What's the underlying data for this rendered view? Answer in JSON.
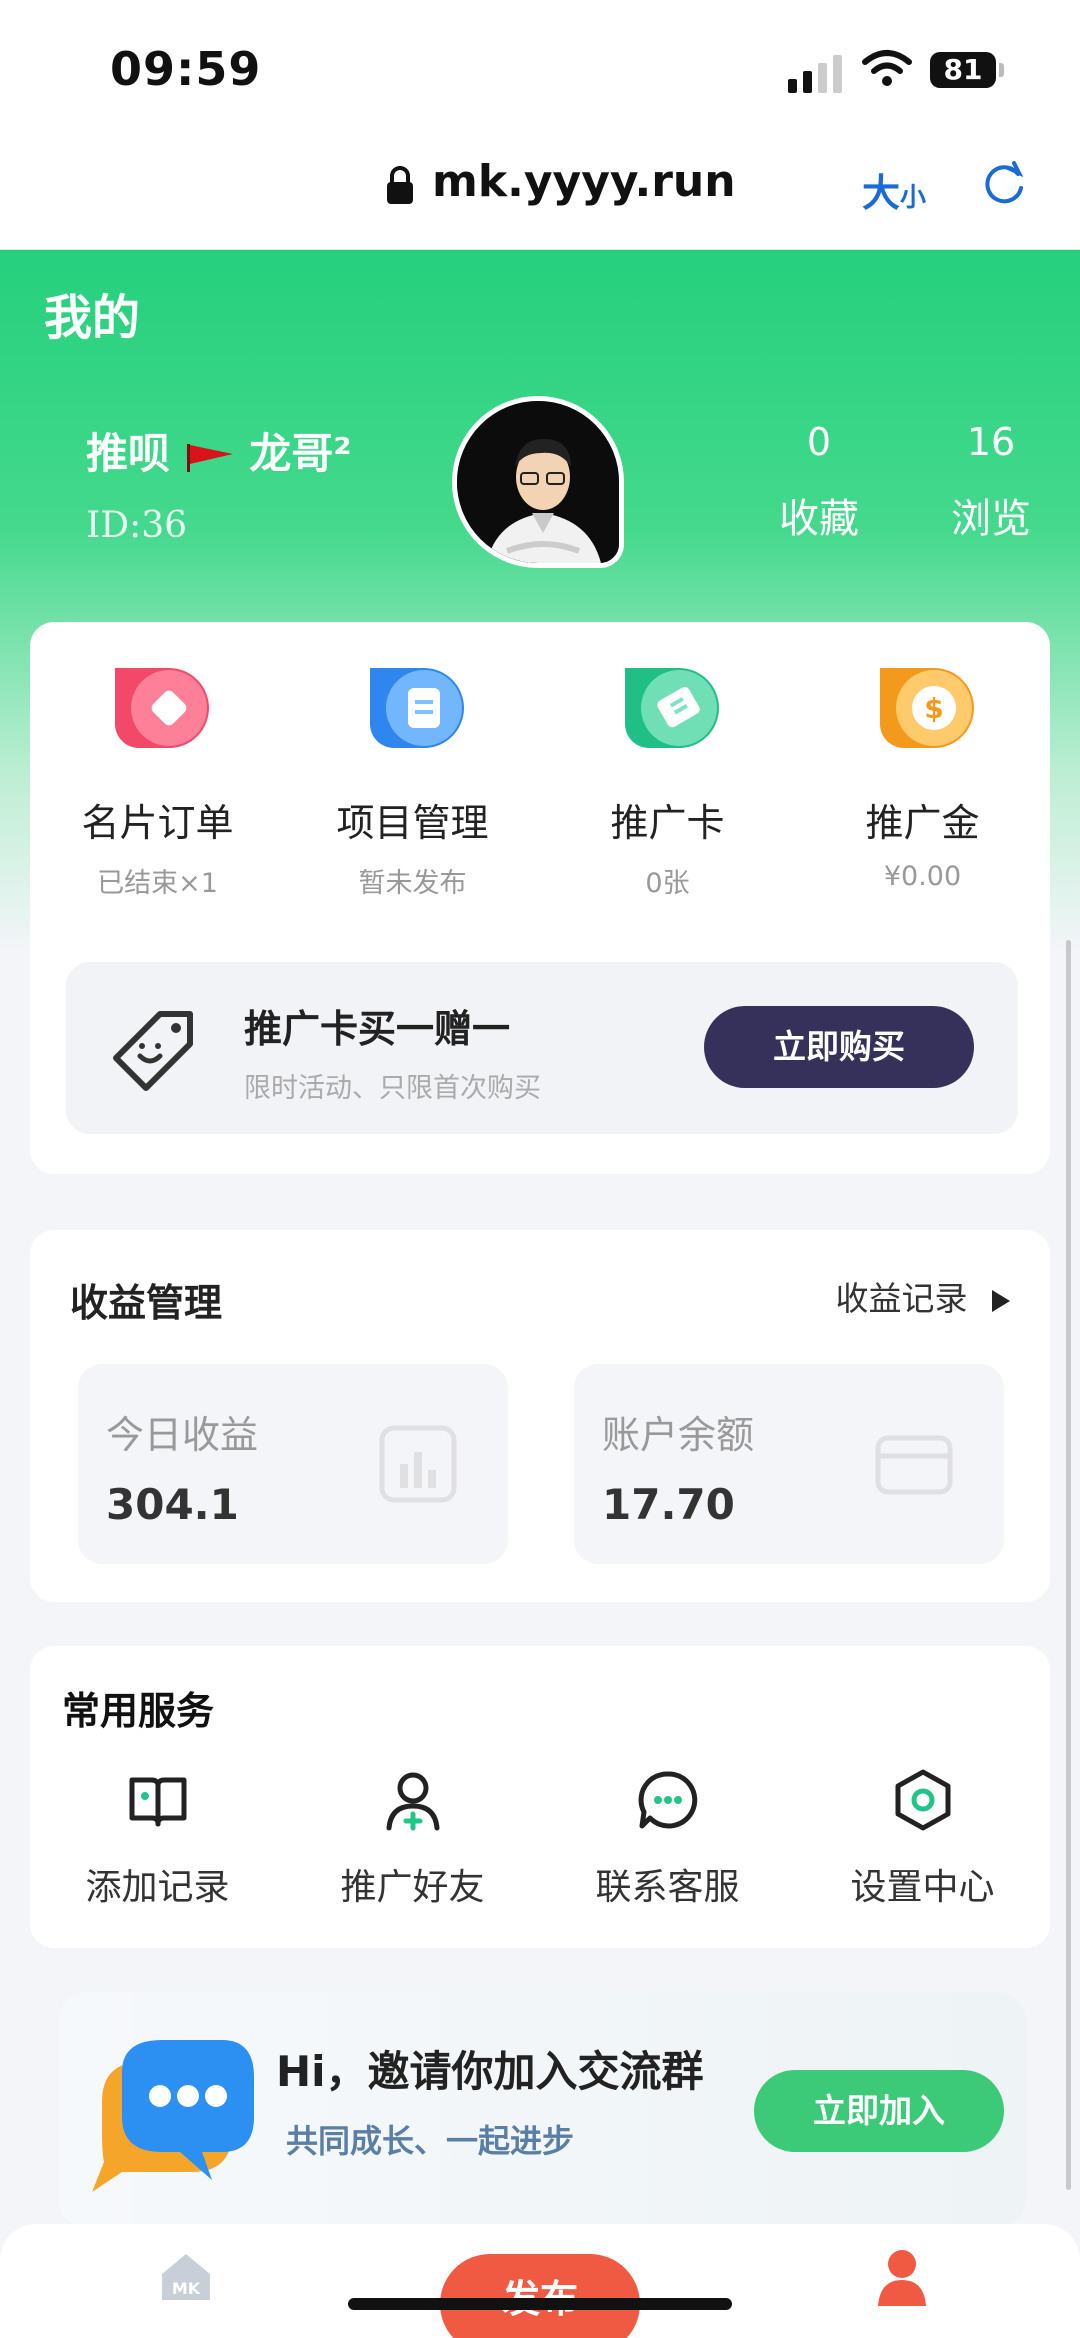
{
  "status_bar": {
    "time": "09:59",
    "battery": "81"
  },
  "browser": {
    "url": "mk.yyyy.run",
    "size_big": "大",
    "size_small": "小"
  },
  "header": {
    "title": "我的",
    "user_name_part1": "推呗",
    "user_name_part2": "龙哥²",
    "user_id": "ID:36",
    "stats": [
      {
        "value": "0",
        "label": "收藏"
      },
      {
        "value": "16",
        "label": "浏览"
      }
    ]
  },
  "quick_grid": [
    {
      "label": "名片订单",
      "sub": "已结束×1",
      "icon": "diamond-card-icon",
      "color": "#f2496b"
    },
    {
      "label": "项目管理",
      "sub": "暂未发布",
      "icon": "document-icon",
      "color": "#3a8ff0"
    },
    {
      "label": "推广卡",
      "sub": "0张",
      "icon": "ticket-icon",
      "color": "#22c487"
    },
    {
      "label": "推广金",
      "sub": "¥0.00",
      "icon": "dollar-coin-icon",
      "color": "#f5a52a"
    }
  ],
  "promo": {
    "title": "推广卡买一赠一",
    "subtitle": "限时活动、只限首次购买",
    "button": "立即购买"
  },
  "earnings": {
    "title": "收益管理",
    "link": "收益记录",
    "today_label": "今日收益",
    "today_value": "304.1",
    "balance_label": "账户余额",
    "balance_value": "17.70"
  },
  "services": {
    "title": "常用服务",
    "items": [
      {
        "label": "添加记录",
        "icon": "book-icon"
      },
      {
        "label": "推广好友",
        "icon": "add-friend-icon"
      },
      {
        "label": "联系客服",
        "icon": "chat-icon"
      },
      {
        "label": "设置中心",
        "icon": "settings-hexagon-icon"
      }
    ]
  },
  "invite": {
    "title": "Hi，邀请你加入交流群",
    "subtitle": "共同成长、一起进步",
    "button": "立即加入"
  },
  "tabbar": {
    "post_label": "发布"
  },
  "colors": {
    "brand_green": "#25d07d",
    "dark_button": "#35315a",
    "join_green": "#3cc978",
    "post_red": "#f05a43"
  }
}
